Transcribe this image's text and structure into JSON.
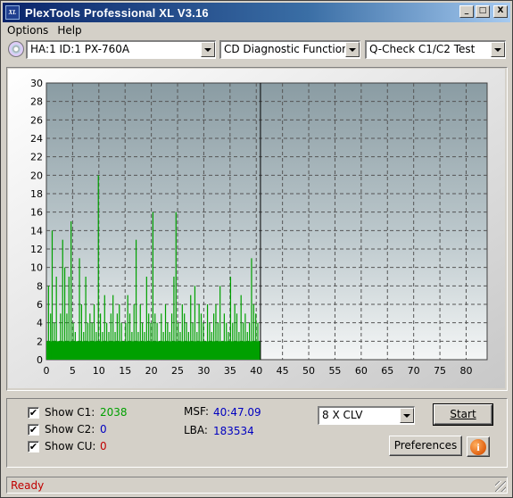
{
  "window": {
    "icon_label": "XL",
    "title": "PlexTools Professional XL V3.16",
    "minimize": "_",
    "maximize": "□",
    "close": "X"
  },
  "menu": [
    "Options",
    "Help"
  ],
  "toolbar": {
    "drive": "HA:1 ID:1  PX-760A",
    "function": "CD Diagnostic Functions",
    "test": "Q-Check C1/C2 Test"
  },
  "chart_data": {
    "type": "bar",
    "title": "",
    "xlabel": "",
    "ylabel": "",
    "xlim": [
      0,
      84
    ],
    "ylim": [
      0,
      30
    ],
    "x_ticks": [
      0,
      5,
      10,
      15,
      20,
      25,
      30,
      35,
      40,
      45,
      50,
      55,
      60,
      65,
      70,
      75,
      80
    ],
    "y_ticks": [
      0,
      2,
      4,
      6,
      8,
      10,
      12,
      14,
      16,
      18,
      20,
      22,
      24,
      26,
      28,
      30
    ],
    "grid": true,
    "series": [
      {
        "name": "C1",
        "color": "#00a000",
        "x": [
          0.3,
          0.7,
          1.0,
          1.4,
          1.8,
          2.2,
          2.6,
          3.0,
          3.4,
          3.8,
          4.2,
          4.6,
          5.0,
          5.4,
          5.8,
          6.2,
          6.6,
          7.0,
          7.4,
          7.8,
          8.2,
          8.6,
          9.0,
          9.4,
          9.8,
          10.2,
          10.6,
          11.0,
          11.4,
          11.8,
          12.2,
          12.6,
          13.0,
          13.4,
          13.8,
          14.2,
          14.6,
          15.0,
          15.4,
          15.8,
          16.2,
          16.6,
          17.0,
          17.4,
          17.8,
          18.2,
          18.6,
          19.0,
          19.4,
          19.8,
          20.2,
          20.6,
          21.0,
          21.4,
          21.8,
          22.2,
          22.6,
          23.0,
          23.4,
          23.8,
          24.2,
          24.6,
          25.0,
          25.4,
          25.8,
          26.2,
          26.6,
          27.0,
          27.4,
          27.8,
          28.2,
          28.6,
          29.0,
          29.4,
          29.8,
          30.2,
          30.6,
          31.0,
          31.4,
          31.8,
          32.2,
          32.6,
          33.0,
          33.4,
          33.8,
          34.2,
          34.6,
          35.0,
          35.4,
          35.8,
          36.2,
          36.6,
          37.0,
          37.4,
          37.8,
          38.2,
          38.6,
          39.0,
          39.4,
          39.8,
          40.2,
          40.6
        ],
        "values": [
          8,
          5,
          14,
          4,
          9,
          2,
          5,
          13,
          10,
          5,
          9,
          15,
          4,
          3,
          2,
          11,
          6,
          3,
          9,
          4,
          5,
          4,
          6,
          3,
          20,
          5,
          3,
          7,
          4,
          3,
          5,
          7,
          3,
          5,
          6,
          4,
          2,
          4,
          7,
          5,
          3,
          6,
          13,
          3,
          6,
          4,
          3,
          9,
          5,
          4,
          16,
          5,
          4,
          2,
          5,
          3,
          6,
          4,
          3,
          5,
          9,
          16,
          4,
          3,
          6,
          5,
          4,
          3,
          7,
          4,
          8,
          3,
          6,
          5,
          4,
          2,
          6,
          4,
          3,
          5,
          6,
          4,
          8,
          2,
          5,
          4,
          3,
          9,
          4,
          6,
          5,
          3,
          7,
          4,
          5,
          3,
          4,
          11,
          6,
          5,
          4,
          2
        ]
      }
    ]
  },
  "cursor_x": 40.8,
  "options": {
    "show_c1": {
      "label": "Show C1:",
      "value": "2038",
      "value_color": "#00a000"
    },
    "show_c2": {
      "label": "Show C2:",
      "value": "0",
      "value_color": "#0000c0"
    },
    "show_cu": {
      "label": "Show CU:",
      "value": "0",
      "value_color": "#c00000"
    },
    "checked_mark": "✔"
  },
  "position": {
    "msf_label": "MSF:",
    "msf_value": "40:47.09",
    "lba_label": "LBA:",
    "lba_value": "183534"
  },
  "speed": "8 X CLV",
  "buttons": {
    "start": "Start",
    "preferences": "Preferences",
    "info": "i"
  },
  "status": "Ready"
}
